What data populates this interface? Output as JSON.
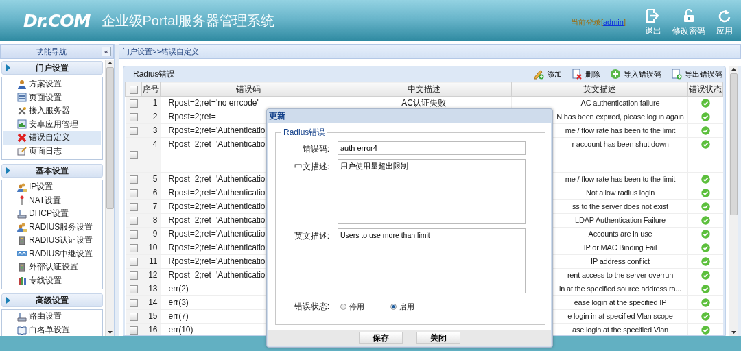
{
  "header": {
    "logo": "Dr.COM",
    "title": "企业级Portal服务器管理系统",
    "login": {
      "prefix": "当前登录[",
      "user": "admin",
      "suffix": "]"
    },
    "actions": [
      {
        "label": "退出"
      },
      {
        "label": "修改密码"
      },
      {
        "label": "应用"
      }
    ]
  },
  "sidebar": {
    "title": "功能导航",
    "collapse": "«",
    "sections": [
      {
        "title": "门户设置",
        "items": [
          {
            "label": "方案设置",
            "selected": false
          },
          {
            "label": "页面设置",
            "selected": false
          },
          {
            "label": "接入服务器",
            "selected": false
          },
          {
            "label": "安卓应用管理",
            "selected": false
          },
          {
            "label": "错误自定义",
            "selected": true
          },
          {
            "label": "页面日志",
            "selected": false
          }
        ]
      },
      {
        "title": "基本设置",
        "items": [
          {
            "label": "IP设置",
            "selected": false
          },
          {
            "label": "NAT设置",
            "selected": false
          },
          {
            "label": "DHCP设置",
            "selected": false
          },
          {
            "label": "RADIUS服务设置",
            "selected": false
          },
          {
            "label": "RADIUS认证设置",
            "selected": false
          },
          {
            "label": "RADIUS中继设置",
            "selected": false
          },
          {
            "label": "外部认证设置",
            "selected": false
          },
          {
            "label": "专线设置",
            "selected": false
          }
        ]
      },
      {
        "title": "高级设置",
        "items": [
          {
            "label": "路由设置",
            "selected": false
          },
          {
            "label": "白名单设置",
            "selected": false
          }
        ]
      }
    ]
  },
  "breadcrumb": "门户设置>>错误自定义",
  "panel": {
    "title": "Radius错误",
    "toolbar": [
      {
        "label": "添加"
      },
      {
        "label": "删除"
      },
      {
        "label": "导入错误码"
      },
      {
        "label": "导出错误码"
      }
    ],
    "table": {
      "columns": [
        "序号",
        "错误码",
        "中文描述",
        "英文描述",
        "错误状态"
      ],
      "header_checked": false,
      "rows": [
        {
          "no": "1",
          "code": "Rpost=2;ret='no errcode'",
          "zh": "AC认证失败",
          "en": "AC authentication failure",
          "checked": false,
          "enabled": true
        },
        {
          "no": "2",
          "code": "Rpost=2;ret=",
          "en": "N has been expired, please log in again",
          "checked": false,
          "enabled": true
        },
        {
          "no": "3",
          "code": "Rpost=2;ret='Authenticatio",
          "en": "me / flow rate has been to the limit",
          "checked": false,
          "enabled": true
        },
        {
          "no": "4",
          "code": "Rpost=2;ret='Authenticatio",
          "en": "r account has been shut down",
          "checked": false,
          "enabled": true
        },
        {
          "no": "5",
          "code": "Rpost=2;ret='Authenticatio",
          "en": "me / flow rate has been to the limit",
          "checked": false,
          "enabled": true
        },
        {
          "no": "6",
          "code": "Rpost=2;ret='Authenticatio",
          "en": "Not allow radius login",
          "checked": false,
          "enabled": true
        },
        {
          "no": "7",
          "code": "Rpost=2;ret='Authenticatio",
          "en": "ss to the server does not exist",
          "checked": false,
          "enabled": true
        },
        {
          "no": "8",
          "code": "Rpost=2;ret='Authenticatio",
          "en": "LDAP Authentication Failure",
          "checked": false,
          "enabled": true
        },
        {
          "no": "9",
          "code": "Rpost=2;ret='Authenticatio",
          "en": "Accounts are in use",
          "checked": false,
          "enabled": true
        },
        {
          "no": "10",
          "code": "Rpost=2;ret='Authenticatio",
          "en": "IP or MAC Binding Fail",
          "checked": false,
          "enabled": true
        },
        {
          "no": "11",
          "code": "Rpost=2;ret='Authenticatio",
          "en": "IP address conflict",
          "checked": false,
          "enabled": true
        },
        {
          "no": "12",
          "code": "Rpost=2;ret='Authenticatio",
          "en": "rent access to the server overrun",
          "checked": false,
          "enabled": true
        },
        {
          "no": "13",
          "code": "err(2)",
          "en": "in at the specified source address ra...",
          "checked": false,
          "enabled": true
        },
        {
          "no": "14",
          "code": "err(3)",
          "en": "ease login at the specified IP",
          "checked": false,
          "enabled": true
        },
        {
          "no": "15",
          "code": "err(7)",
          "en": "e login in at specified Vlan scope",
          "checked": false,
          "enabled": true
        },
        {
          "no": "16",
          "code": "err(10)",
          "en": "ase login at the specified Vlan",
          "checked": false,
          "enabled": true
        }
      ]
    }
  },
  "dialog": {
    "title": "更新",
    "legend": "Radius错误",
    "fields": [
      {
        "kind": "input",
        "label": "错误码:",
        "value": "auth error4"
      },
      {
        "kind": "textarea",
        "label": "中文描述:",
        "value": "用户使用量超出限制"
      },
      {
        "kind": "textarea",
        "label": "英文描述:",
        "value": "Users to use more than limit"
      },
      {
        "kind": "radio",
        "label": "错误状态:",
        "options": [
          {
            "label": "停用",
            "selected": false
          },
          {
            "label": "启用",
            "selected": true
          }
        ]
      }
    ],
    "buttons": [
      "保存",
      "关闭"
    ]
  }
}
